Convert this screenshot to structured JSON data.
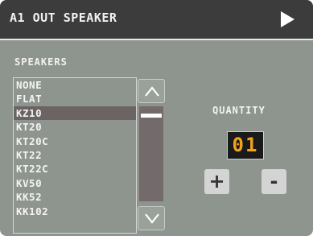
{
  "header": {
    "title": "A1 OUT SPEAKER",
    "next_icon": "play-triangle-icon"
  },
  "speakers": {
    "label": "SPEAKERS",
    "items": [
      "NONE",
      "FLAT",
      "KZ10",
      "KT20",
      "KT20C",
      "KT22",
      "KT22C",
      "KV50",
      "KK52",
      "KK102"
    ],
    "selected": "KZ10"
  },
  "scroll": {
    "up_icon": "chevron-up-icon",
    "down_icon": "chevron-down-icon"
  },
  "quantity": {
    "label": "QUANTITY",
    "value": "01",
    "plus_label": "+",
    "minus_label": "-"
  },
  "colors": {
    "panel_bg": "#8e958e",
    "header_bg": "#3c3c3c",
    "selected_row": "#6c6464",
    "qty_text": "#f3a21c"
  }
}
